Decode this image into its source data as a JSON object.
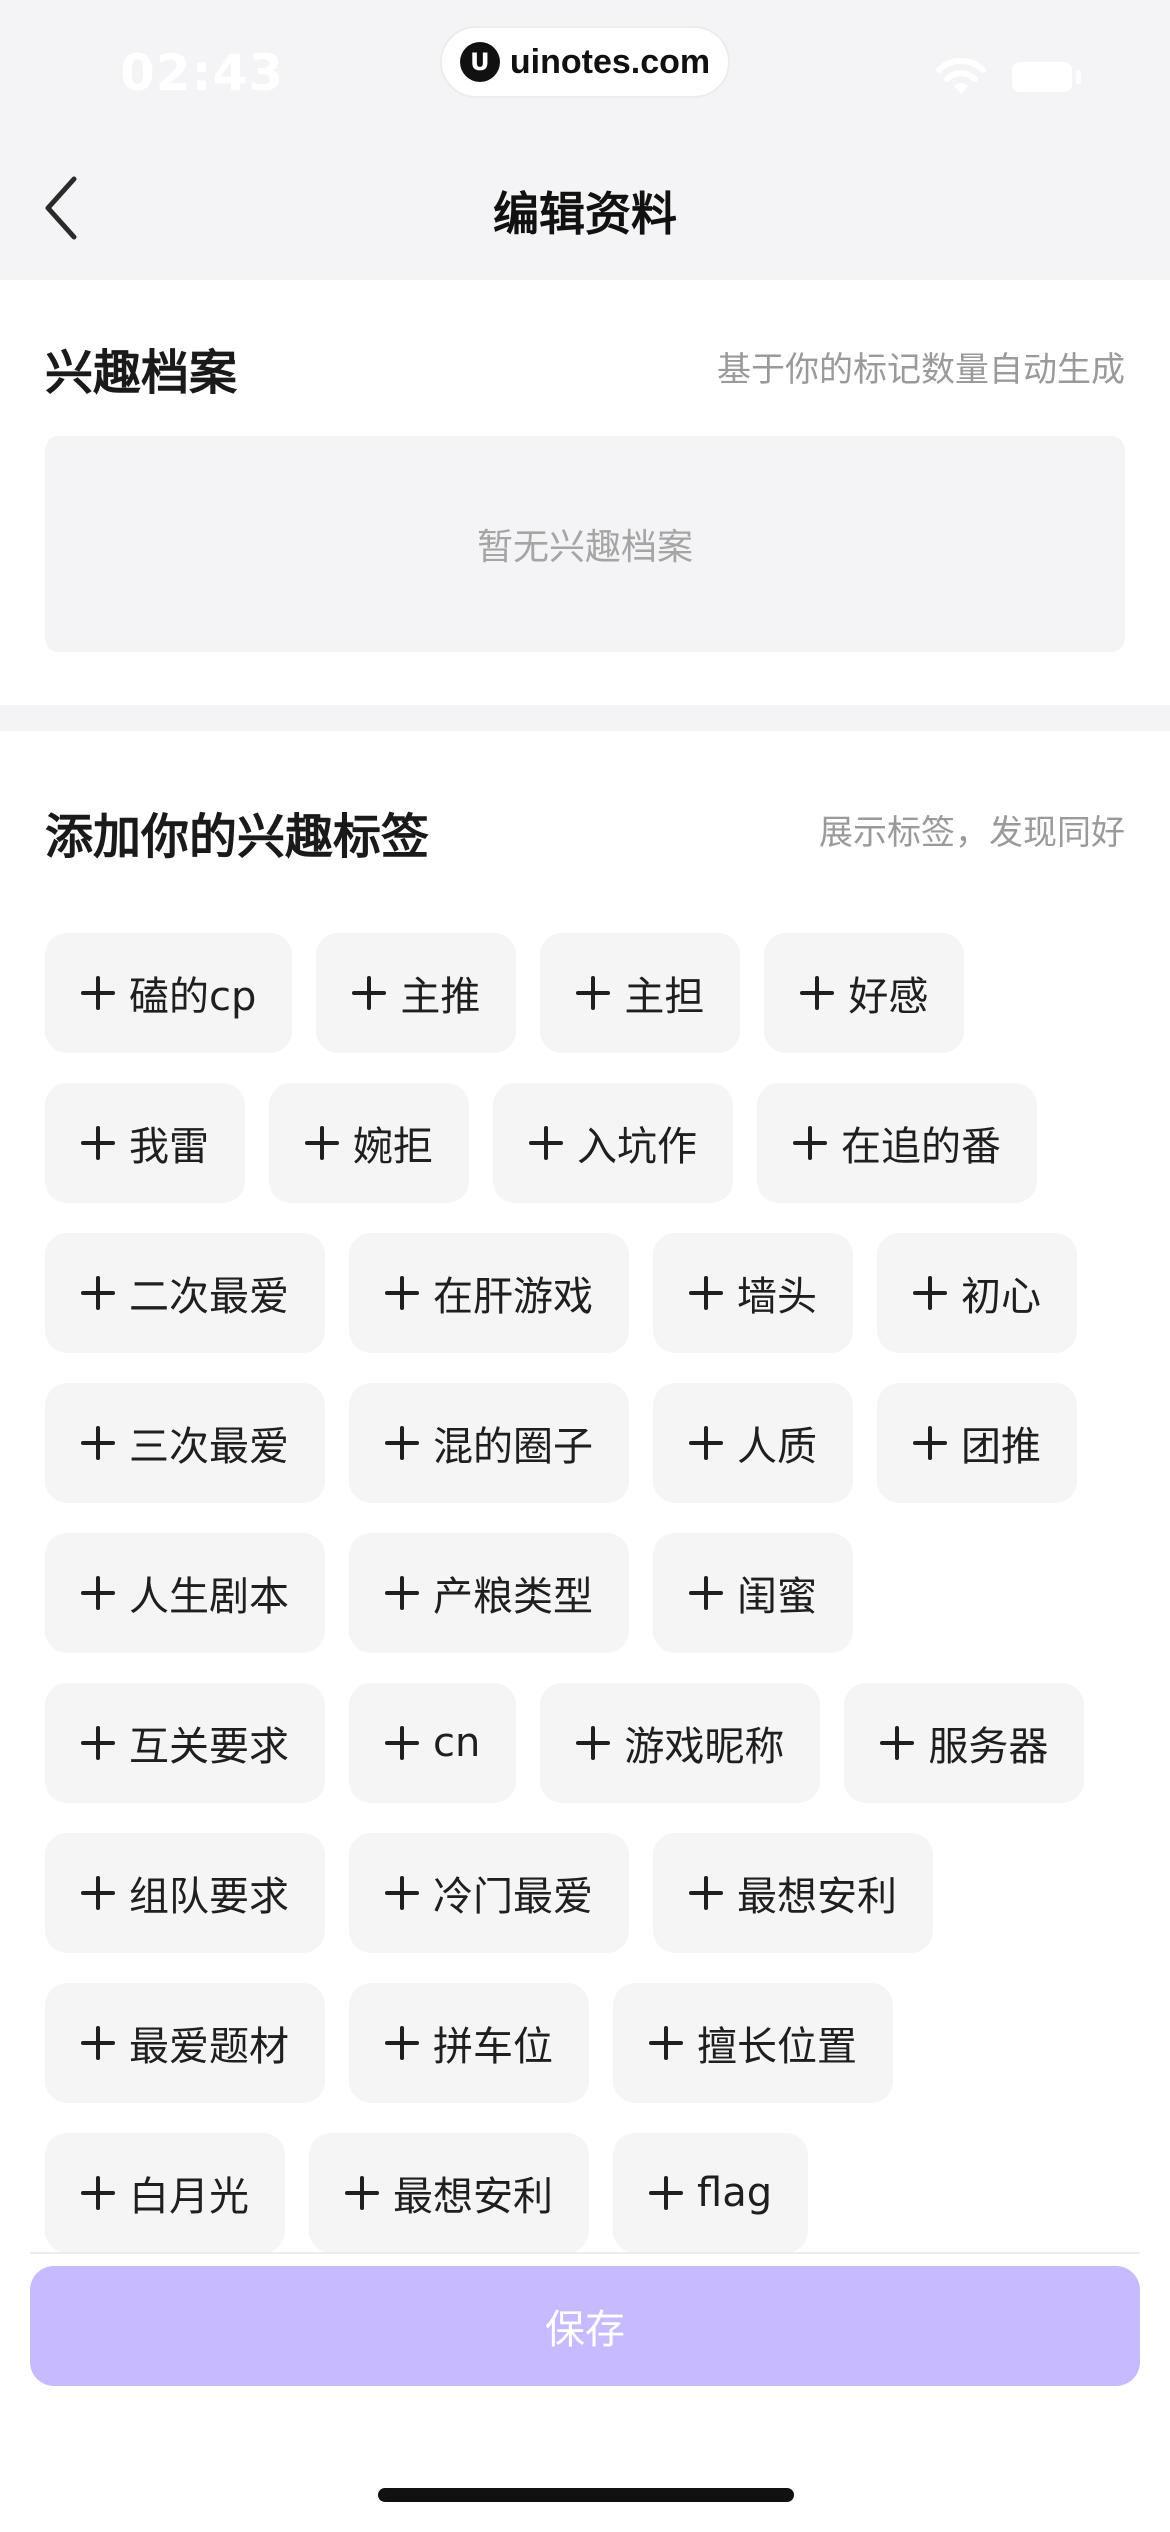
{
  "status_bar": {
    "time": "02:43"
  },
  "watermark": {
    "logo": "U",
    "text": "uinotes.com"
  },
  "nav": {
    "title": "编辑资料"
  },
  "interest_profile": {
    "title": "兴趣档案",
    "hint": "基于你的标记数量自动生成",
    "empty_text": "暂无兴趣档案"
  },
  "interest_tags": {
    "title": "添加你的兴趣标签",
    "hint": "展示标签，发现同好",
    "rows": [
      [
        "磕的cp",
        "主推",
        "主担",
        "好感"
      ],
      [
        "我雷",
        "婉拒",
        "入坑作",
        "在追的番"
      ],
      [
        "二次最爱",
        "在肝游戏",
        "墙头",
        "初心"
      ],
      [
        "三次最爱",
        "混的圈子",
        "人质",
        "团推"
      ],
      [
        "人生剧本",
        "产粮类型",
        "闺蜜"
      ],
      [
        "互关要求",
        "cn",
        "游戏昵称",
        "服务器"
      ],
      [
        "组队要求",
        "冷门最爱",
        "最想安利"
      ],
      [
        "最爱题材",
        "拼车位",
        "擅长位置"
      ],
      [
        "白月光",
        "最想安利",
        "flag"
      ]
    ]
  },
  "footer": {
    "save_label": "保存",
    "save_color": "#c8baff"
  }
}
